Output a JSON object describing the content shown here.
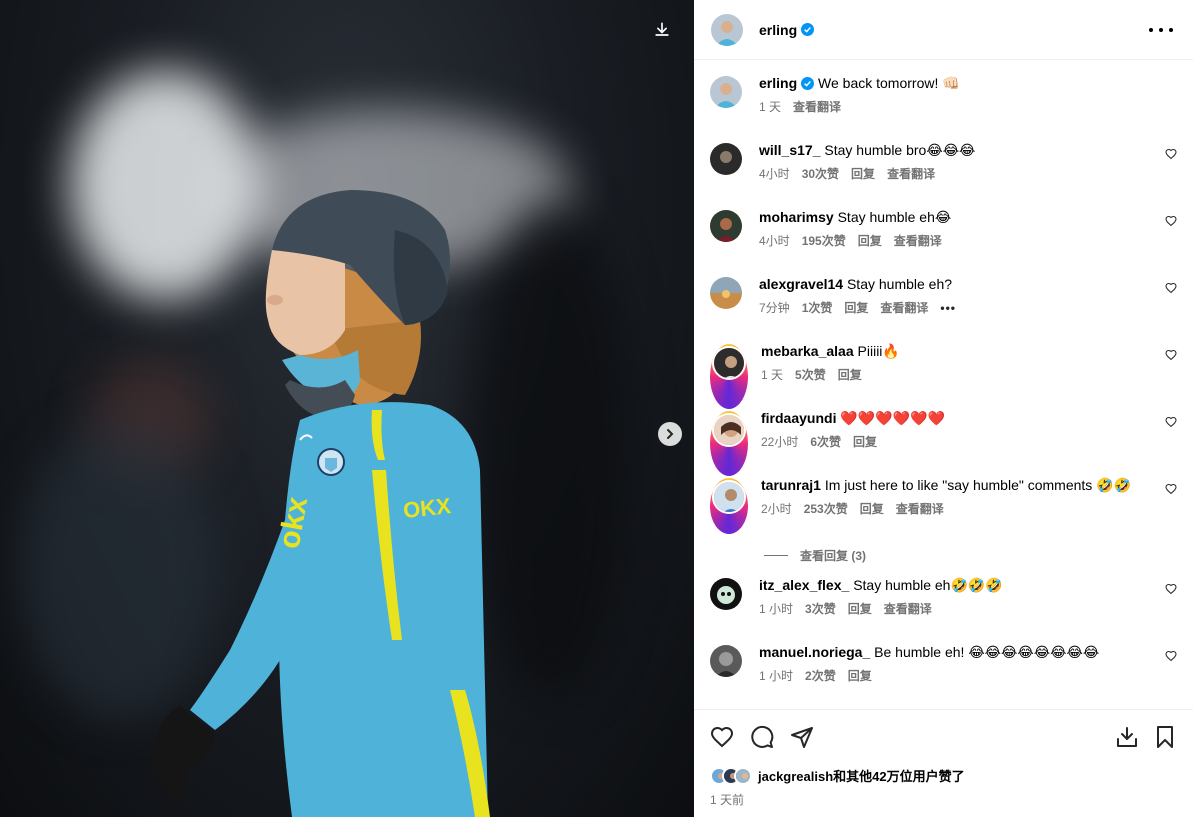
{
  "post": {
    "author": "erling",
    "verified": true,
    "caption": {
      "text": "We back tomorrow! 👊🏻",
      "time": "1 天",
      "translate": "查看翻译"
    }
  },
  "comments": [
    {
      "user": "will_s17_",
      "text": "Stay humble bro😂😂😂",
      "time": "4小时",
      "likes": "30次赞",
      "reply": "回复",
      "translate": "查看翻译",
      "story_ring": false
    },
    {
      "user": "moharimsy",
      "text": "Stay humble eh😂",
      "time": "4小时",
      "likes": "195次赞",
      "reply": "回复",
      "translate": "查看翻译",
      "story_ring": false
    },
    {
      "user": "alexgravel14",
      "text": "Stay humble eh?",
      "time": "7分钟",
      "likes": "1次赞",
      "reply": "回复",
      "translate": "查看翻译",
      "story_ring": false,
      "has_more": true
    },
    {
      "user": "mebarka_alaa",
      "text": "Piiiii🔥",
      "time": "1 天",
      "likes": "5次赞",
      "reply": "回复",
      "translate": "",
      "story_ring": true
    },
    {
      "user": "firdaayundi",
      "text": "❤️❤️❤️❤️❤️❤️",
      "time": "22小时",
      "likes": "6次赞",
      "reply": "回复",
      "translate": "",
      "story_ring": true
    },
    {
      "user": "tarunraj1",
      "text": "Im just here to like \"say humble\" comments 🤣🤣",
      "time": "2小时",
      "likes": "253次赞",
      "reply": "回复",
      "translate": "查看翻译",
      "story_ring": true
    },
    {
      "user": "itz_alex_flex_",
      "text": "Stay humble eh🤣🤣🤣",
      "time": "1 小时",
      "likes": "3次赞",
      "reply": "回复",
      "translate": "查看翻译",
      "story_ring": false
    },
    {
      "user": "manuel.noriega_",
      "text": "Be humble eh! 😂😂😂😂😂😂😂😂",
      "time": "1 小时",
      "likes": "2次赞",
      "reply": "回复",
      "translate": "",
      "story_ring": false
    }
  ],
  "view_replies": "查看回复 (3)",
  "likes_summary": "jackgrealish和其他42万位用户赞了",
  "post_time": "1 天前",
  "icons": {
    "like": "heart-icon",
    "comment": "comment-icon",
    "share": "share-icon",
    "save_download": "download-icon",
    "bookmark": "bookmark-icon",
    "more": "more-icon",
    "next": "chevron-right-icon"
  },
  "colors": {
    "verified": "#0095f6",
    "meta_text": "#737373",
    "jersey": "#4fb3d9",
    "sponsor": "#e8e31e"
  }
}
